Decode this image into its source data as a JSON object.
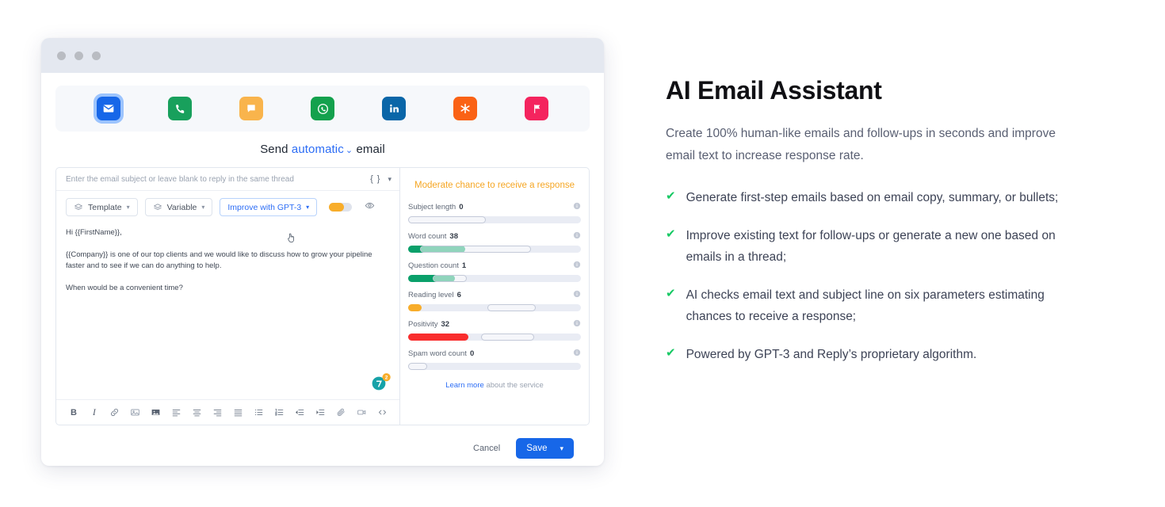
{
  "window": {
    "channels": [
      {
        "name": "email",
        "icon": "envelope-icon",
        "color": "#1767e8",
        "active": true
      },
      {
        "name": "call",
        "icon": "phone-icon",
        "color": "#18a05c",
        "active": false
      },
      {
        "name": "sms",
        "icon": "chat-bubble-icon",
        "color": "#f9b košt",
        "active": false
      },
      {
        "name": "whatsapp",
        "icon": "whatsapp-icon",
        "color": "#13a14d",
        "active": false
      },
      {
        "name": "linkedin",
        "icon": "linkedin-icon",
        "color": "#0a66a8",
        "active": false
      },
      {
        "name": "task",
        "icon": "asterisk-icon",
        "color": "#fa6215",
        "active": false
      },
      {
        "name": "manual-task",
        "icon": "flag-icon",
        "color": "#f4245e",
        "active": false
      }
    ],
    "send_line": {
      "prefix": "Send",
      "mode": "automatic",
      "suffix": "email",
      "caret": "⌄"
    },
    "subject_placeholder": "Enter the email subject or leave blank to reply in the same thread",
    "subject_value": "",
    "brace_icon_label": "{ }",
    "toolbar": {
      "template_label": "Template",
      "variable_label": "Variable",
      "improve_label": "Improve with GPT-3",
      "caret": "⌄"
    },
    "body_paragraphs": [
      "Hi {{FirstName}},",
      "{{Company}} is one of our top clients and we would like to discuss how to grow your pipeline faster and to see if we can do anything to help.",
      "When would be a convenient time?"
    ],
    "agent_badge_count": "2",
    "format_buttons": [
      {
        "name": "bold",
        "glyph": "B"
      },
      {
        "name": "italic",
        "glyph": "I"
      },
      {
        "name": "link",
        "glyph": "link-icon"
      },
      {
        "name": "image",
        "glyph": "image-icon"
      },
      {
        "name": "image-filled",
        "glyph": "image-filled-icon"
      },
      {
        "name": "align-left",
        "glyph": "align-left-icon"
      },
      {
        "name": "align-center",
        "glyph": "align-center-icon"
      },
      {
        "name": "align-right",
        "glyph": "align-right-icon"
      },
      {
        "name": "align-justify",
        "glyph": "align-justify-icon"
      },
      {
        "name": "bullet-list",
        "glyph": "bullet-list-icon"
      },
      {
        "name": "numbered-list",
        "glyph": "numbered-list-icon"
      },
      {
        "name": "outdent",
        "glyph": "outdent-icon"
      },
      {
        "name": "indent",
        "glyph": "indent-icon"
      },
      {
        "name": "attachment",
        "glyph": "paperclip-icon"
      },
      {
        "name": "video",
        "glyph": "video-icon"
      },
      {
        "name": "code",
        "glyph": "code-icon"
      }
    ],
    "score": {
      "title": "Moderate chance to receive a response",
      "title_color": "#f5a623",
      "metrics": [
        {
          "label": "Subject length",
          "value": "0",
          "fill_pct": 0,
          "fill_color": "#e9ecf4",
          "zone_start_pct": 0,
          "zone_end_pct": 45
        },
        {
          "label": "Word count",
          "value": "38",
          "fill_pct": 33,
          "fill_color": "#0aa06a",
          "zone_start_pct": 7,
          "zone_end_pct": 71
        },
        {
          "label": "Question count",
          "value": "1",
          "fill_pct": 27,
          "fill_color": "#0aa06a",
          "zone_start_pct": 14,
          "zone_end_pct": 34
        },
        {
          "label": "Reading level",
          "value": "6",
          "fill_pct": 8,
          "fill_color": "#f8ad2a",
          "zone_start_pct": 46,
          "zone_end_pct": 74
        },
        {
          "label": "Positivity",
          "value": "32",
          "fill_pct": 35,
          "fill_color": "#f92d2d",
          "zone_start_pct": 42,
          "zone_end_pct": 73
        },
        {
          "label": "Spam word count",
          "value": "0",
          "fill_pct": 0,
          "fill_color": "#e9ecf4",
          "zone_start_pct": 0,
          "zone_end_pct": 11
        }
      ],
      "learn_link": "Learn more",
      "learn_rest": "about the service"
    },
    "footer": {
      "cancel_label": "Cancel",
      "save_label": "Save",
      "save_caret": "⌄",
      "save_color": "#1767e8"
    }
  },
  "copy": {
    "heading": "AI Email Assistant",
    "lead": "Create 100% human-like emails and follow-ups in seconds and improve email text to increase response rate.",
    "features": [
      "Generate first-step emails based on email copy, summary, or bullets;",
      "Improve existing text for follow-ups or generate a new one based on emails in a thread;",
      "AI checks email text and subject line on six parameters estimating chances to receive a response;",
      "Powered by GPT-3 and Reply’s proprietary algorithm."
    ],
    "tick_glyph": "✔",
    "tick_color": "#17c964"
  }
}
